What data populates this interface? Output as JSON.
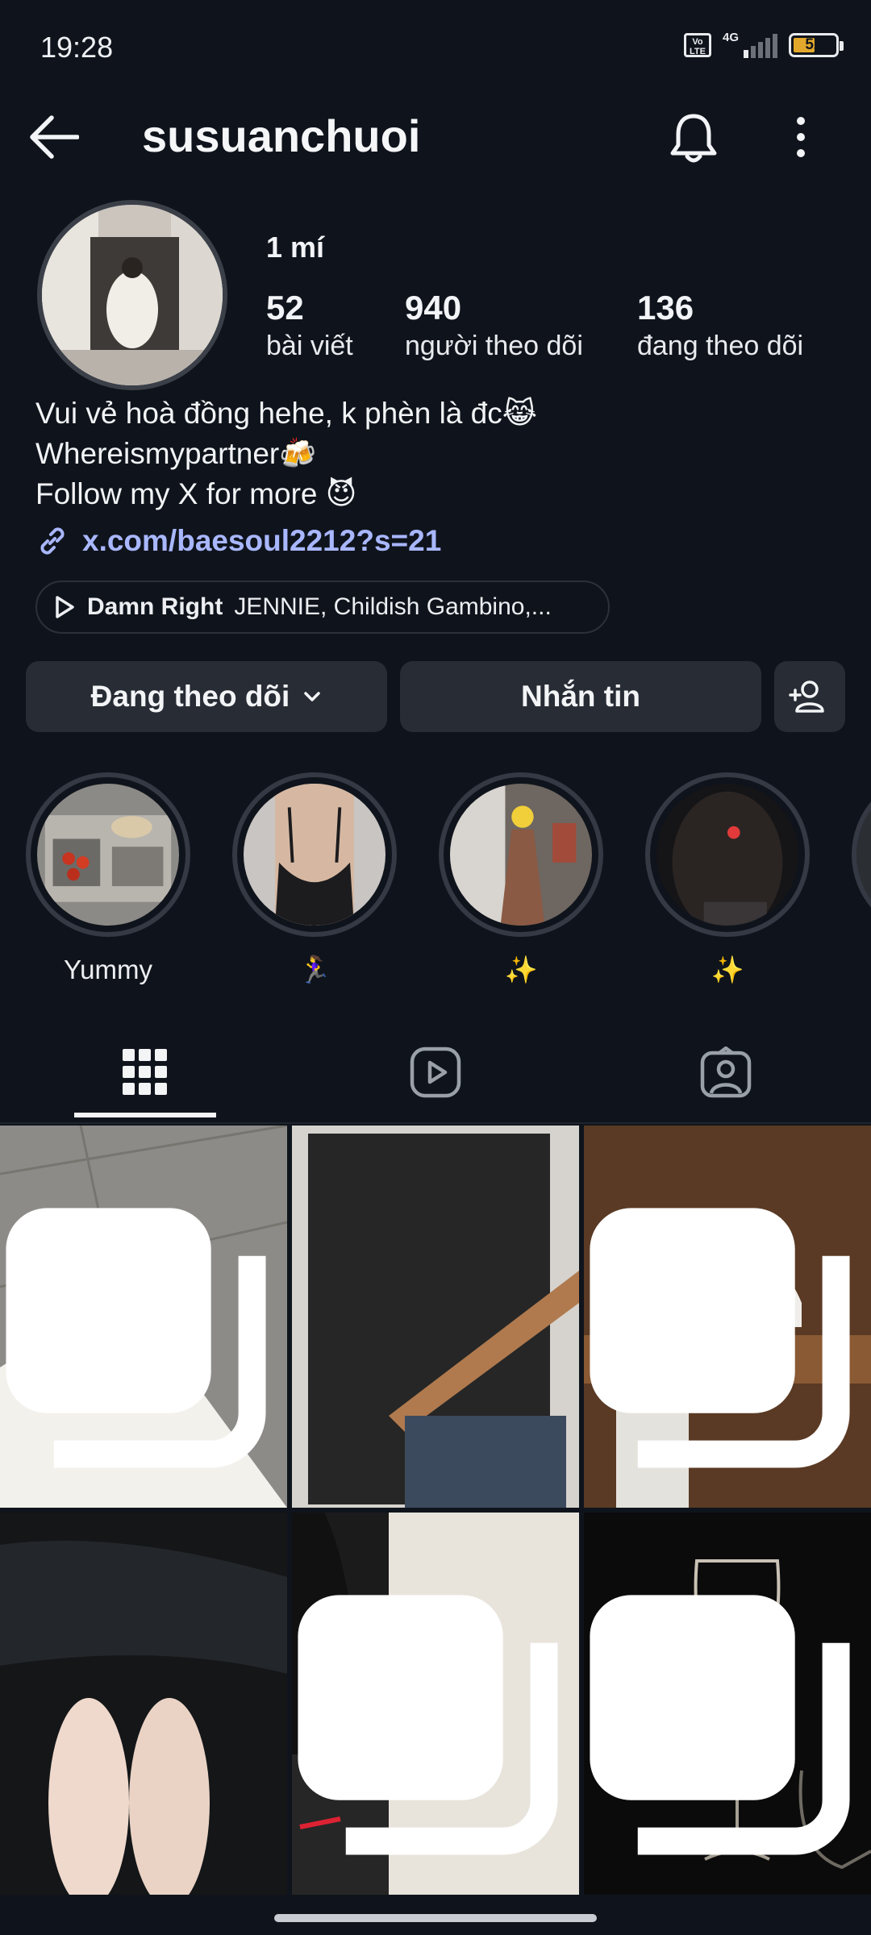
{
  "status_bar": {
    "time": "19:28",
    "network": "4G",
    "volte": "Vo LTE",
    "battery": "52"
  },
  "header": {
    "username": "susuanchuoi"
  },
  "profile": {
    "name": "1 mí",
    "stats": [
      {
        "value": "52",
        "label": "bài viết"
      },
      {
        "value": "940",
        "label": "người theo dõi"
      },
      {
        "value": "136",
        "label": "đang theo dõi"
      }
    ],
    "bio": [
      "Vui vẻ hoà đồng hehe, k phèn là đc😹",
      "Whereismypartner🍻",
      "Follow my X for more 😈"
    ],
    "link": "x.com/baesoul2212?s=21",
    "music": {
      "title": "Damn Right",
      "artists": "JENNIE, Childish Gambino,..."
    }
  },
  "actions": {
    "following": "Đang theo dõi",
    "message": "Nhắn tin"
  },
  "highlights": [
    {
      "caption": "Yummy"
    },
    {
      "caption": "🏃‍♀️"
    },
    {
      "caption": "✨"
    },
    {
      "caption": "✨"
    }
  ],
  "tabs": [
    {
      "name": "grid-icon",
      "active": true
    },
    {
      "name": "reels-icon",
      "active": false
    },
    {
      "name": "tagged-icon",
      "active": false
    }
  ],
  "posts": [
    {
      "multi": true
    },
    {
      "multi": false
    },
    {
      "multi": true
    },
    {
      "multi": false
    },
    {
      "multi": true
    },
    {
      "multi": true
    }
  ]
}
